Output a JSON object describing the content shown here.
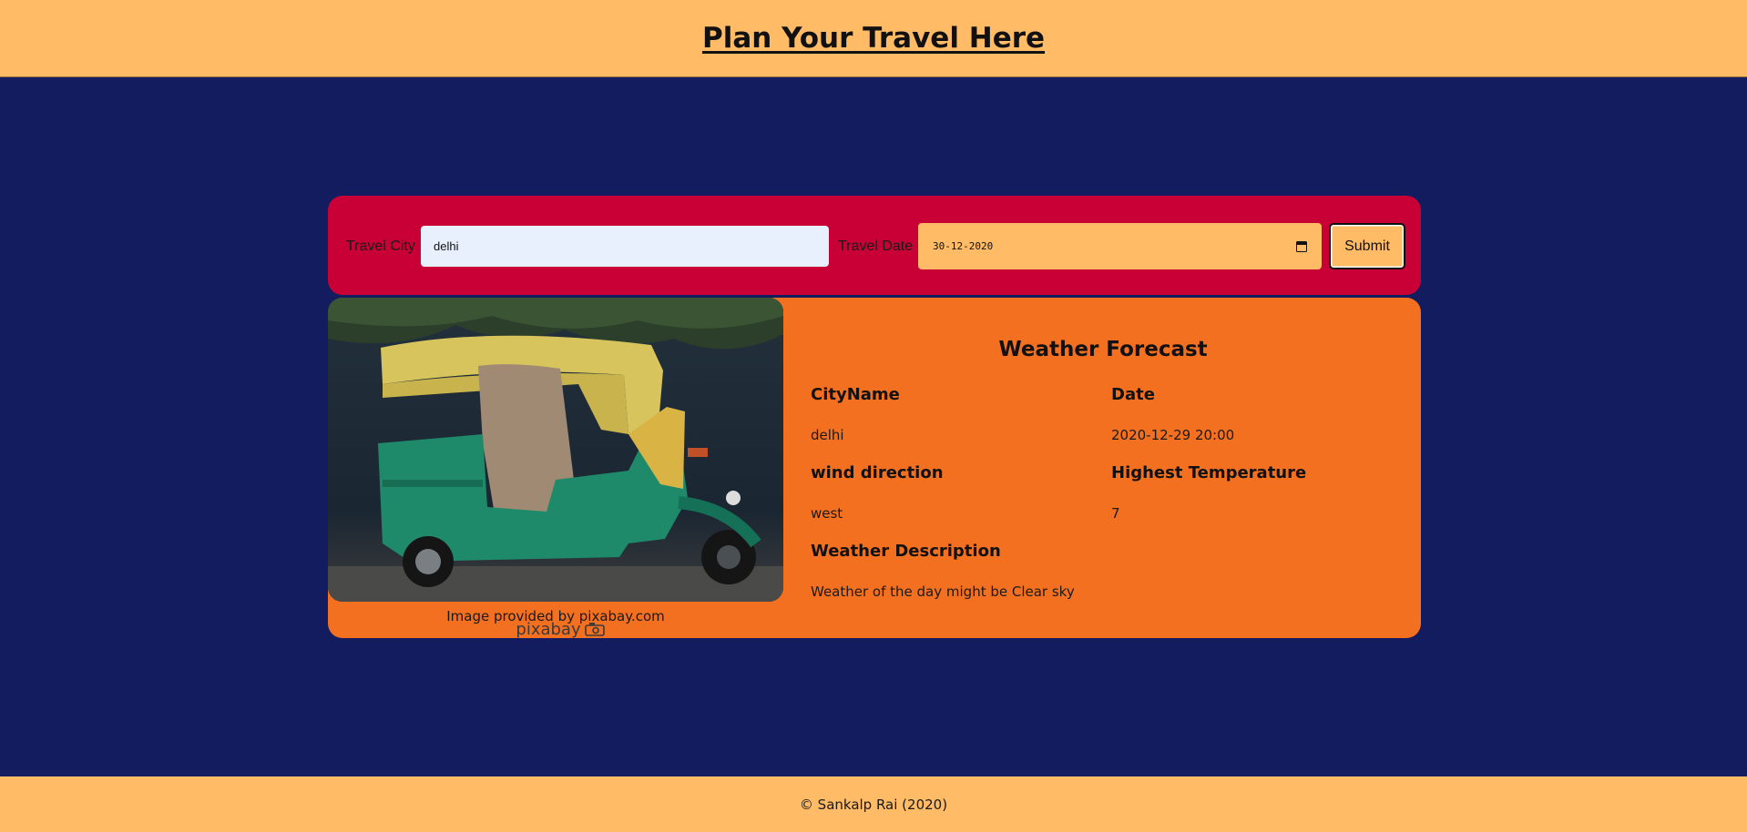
{
  "header": {
    "title": "Plan Your Travel Here"
  },
  "form": {
    "city_label": "Travel City",
    "city_value": "delhi",
    "date_label": "Travel Date",
    "date_value": "30-12-2020",
    "submit_label": "Submit"
  },
  "result": {
    "image_credit": "Image provided by pixabay.com",
    "logo_text": "pixabay",
    "weather": {
      "title": "Weather Forecast",
      "city_heading": "CityName",
      "city_value": "delhi",
      "date_heading": "Date",
      "date_value": "2020-12-29 20:00",
      "wind_heading": "wind direction",
      "wind_value": "west",
      "temp_heading": "Highest Temperature",
      "temp_value": "7",
      "desc_heading": "Weather Description",
      "desc_value": "Weather of the day might be Clear sky"
    }
  },
  "footer": {
    "text": "© Sankalp Rai (2020)"
  },
  "colors": {
    "background": "#121c5e",
    "header": "#ffbb66",
    "form_card": "#c80036",
    "result_card": "#f37021",
    "city_input": "#e8f0fe"
  }
}
